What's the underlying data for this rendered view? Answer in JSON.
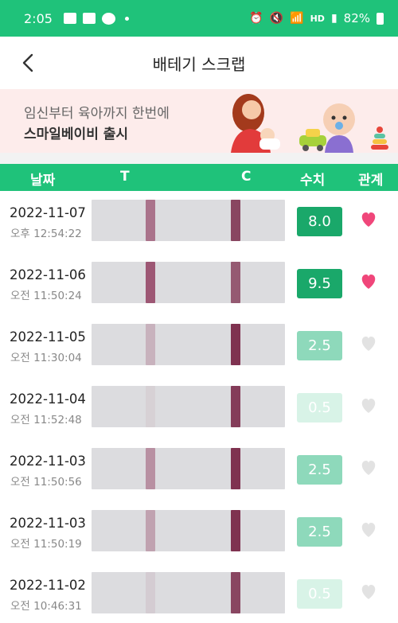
{
  "status_bar": {
    "time": "2:05",
    "hd_label": "HD",
    "battery_text": "82%"
  },
  "header": {
    "title": "배테기 스크랩"
  },
  "banner": {
    "line1": "임신부터 육아까지 한번에",
    "line2": "스마일베이비 출시"
  },
  "columns": {
    "date": "날짜",
    "t": "T",
    "c": "C",
    "value": "수치",
    "relation": "관계"
  },
  "colors": {
    "accent": "#1fc27a",
    "value_high": "#1aa86a",
    "value_mid": "#8ed9bb",
    "value_low": "#d8f3e7",
    "heart_on": "#f0467a",
    "heart_off": "#e2e2e2"
  },
  "rows": [
    {
      "date": "2022-11-07",
      "time": "오후 12:54:22",
      "value": "8.0",
      "level": "high",
      "heart": "on",
      "t_band": 0.55,
      "c_band": 0.75
    },
    {
      "date": "2022-11-06",
      "time": "오전 11:50:24",
      "value": "9.5",
      "level": "high",
      "heart": "on",
      "t_band": 0.7,
      "c_band": 0.65
    },
    {
      "date": "2022-11-05",
      "time": "오전 11:30:04",
      "value": "2.5",
      "level": "mid",
      "heart": "off",
      "t_band": 0.22,
      "c_band": 0.85
    },
    {
      "date": "2022-11-04",
      "time": "오전 11:52:48",
      "value": "0.5",
      "level": "low",
      "heart": "off",
      "t_band": 0.06,
      "c_band": 0.8
    },
    {
      "date": "2022-11-03",
      "time": "오전 11:50:56",
      "value": "2.5",
      "level": "mid",
      "heart": "off",
      "t_band": 0.4,
      "c_band": 0.85
    },
    {
      "date": "2022-11-03",
      "time": "오전 11:50:19",
      "value": "2.5",
      "level": "mid",
      "heart": "off",
      "t_band": 0.3,
      "c_band": 0.85
    },
    {
      "date": "2022-11-02",
      "time": "오전 10:46:31",
      "value": "0.5",
      "level": "low",
      "heart": "off",
      "t_band": 0.08,
      "c_band": 0.75
    }
  ]
}
